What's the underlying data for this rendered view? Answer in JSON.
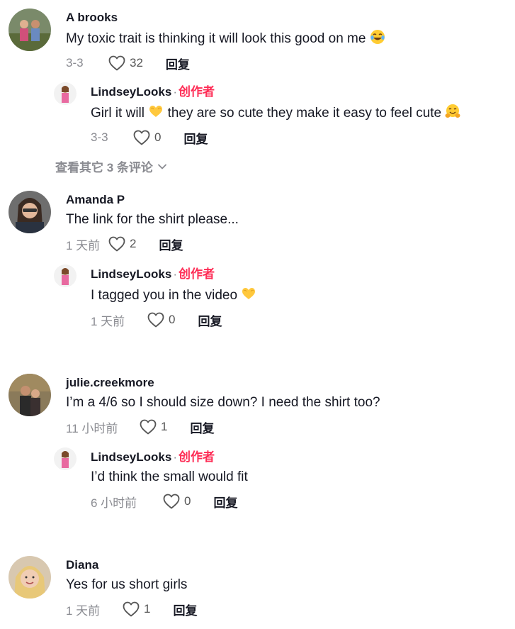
{
  "comments": [
    {
      "username": "A brooks",
      "text": "My toxic trait is thinking it will look this good on me",
      "emoji": "face-with-tears-of-joy",
      "date": "3-3",
      "likes": "32",
      "reply_label": "回复",
      "reply": {
        "username": "LindseyLooks",
        "separator": "·",
        "creator_badge": "创作者",
        "text_part1": "Girl it will",
        "emoji1": "heart-hands",
        "text_part2": "they are so cute they make it easy to feel cute",
        "emoji2": "hugging-face",
        "date": "3-3",
        "likes": "0",
        "reply_label": "回复"
      },
      "view_more": "查看其它 3 条评论"
    },
    {
      "username": "Amanda P",
      "text": "The link for the shirt please...",
      "date": "1 天前",
      "likes": "2",
      "reply_label": "回复",
      "reply": {
        "username": "LindseyLooks",
        "separator": "·",
        "creator_badge": "创作者",
        "text": "I tagged you in the video",
        "emoji": "heart-hands",
        "date": "1 天前",
        "likes": "0",
        "reply_label": "回复"
      }
    },
    {
      "username": "julie.creekmore",
      "text": "I’m a 4/6 so I should size down? I need the shirt too?",
      "date": "11 小时前",
      "likes": "1",
      "reply_label": "回复",
      "reply": {
        "username": "LindseyLooks",
        "separator": "·",
        "creator_badge": "创作者",
        "text": "I’d think the small would fit",
        "date": "6 小时前",
        "likes": "0",
        "reply_label": "回复"
      }
    },
    {
      "username": "Diana",
      "text": "Yes for us short girls",
      "date": "1 天前",
      "likes": "1",
      "reply_label": "回复"
    }
  ],
  "colors": {
    "creator": "#fe2c55",
    "secondary": "#8a8b91",
    "primary": "#161823"
  }
}
